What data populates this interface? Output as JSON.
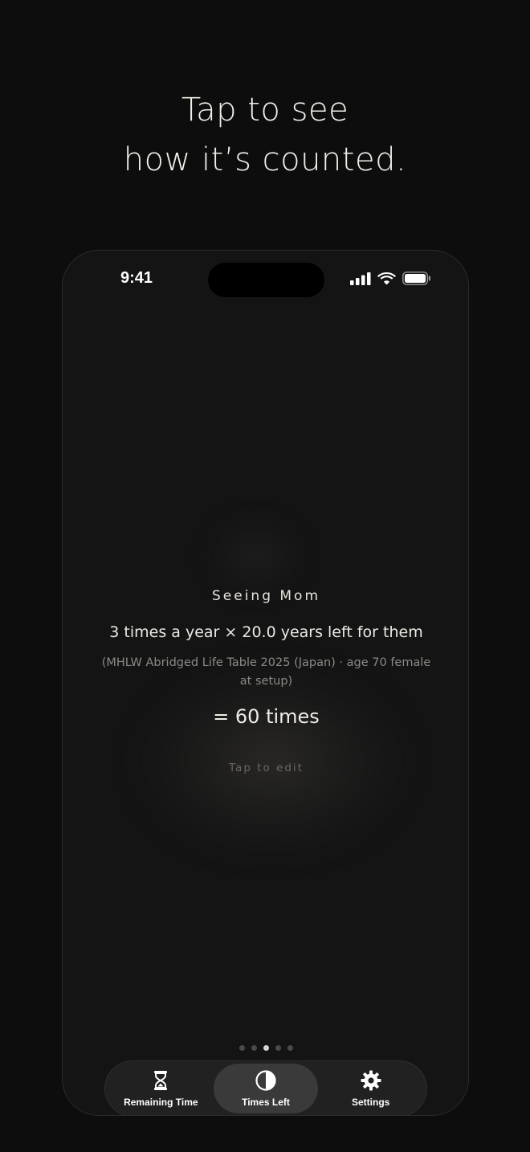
{
  "headline": {
    "line1": "Tap to see",
    "line2": "how it’s counted."
  },
  "status_bar": {
    "time": "9:41",
    "icons": [
      "cellular-signal-icon",
      "wifi-icon",
      "battery-icon"
    ]
  },
  "card": {
    "title": "Seeing Mom",
    "formula": "3 times a year × 20.0 years left for them",
    "source": "(MHLW Abridged Life Table 2025 (Japan) · age 70 female at setup)",
    "result": "= 60 times",
    "edit_hint": "Tap to edit"
  },
  "page_indicator": {
    "count": 5,
    "active_index": 2
  },
  "tabs": [
    {
      "label": "Remaining Time",
      "icon": "hourglass-icon",
      "selected": false
    },
    {
      "label": "Times Left",
      "icon": "half-circle-icon",
      "selected": true
    },
    {
      "label": "Settings",
      "icon": "gear-icon",
      "selected": false
    }
  ],
  "colors": {
    "background": "#0d0d0d",
    "phone_background": "#141414",
    "tab_selected": "#3a3a3a",
    "text_primary": "#ece9e2"
  }
}
